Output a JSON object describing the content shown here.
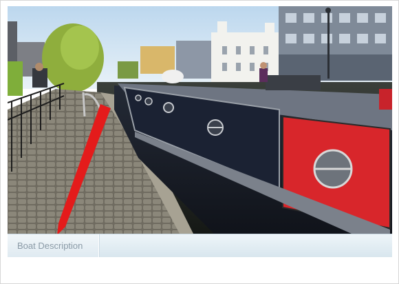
{
  "caption": {
    "label": "Boat Description"
  },
  "colors": {
    "boat_red": "#d8262b",
    "boat_navy": "#1f2430",
    "arrow_red": "#e41b1b",
    "caption_text": "#8a9aa6"
  },
  "icons": {
    "arrow": "red-arrow-annotation"
  }
}
